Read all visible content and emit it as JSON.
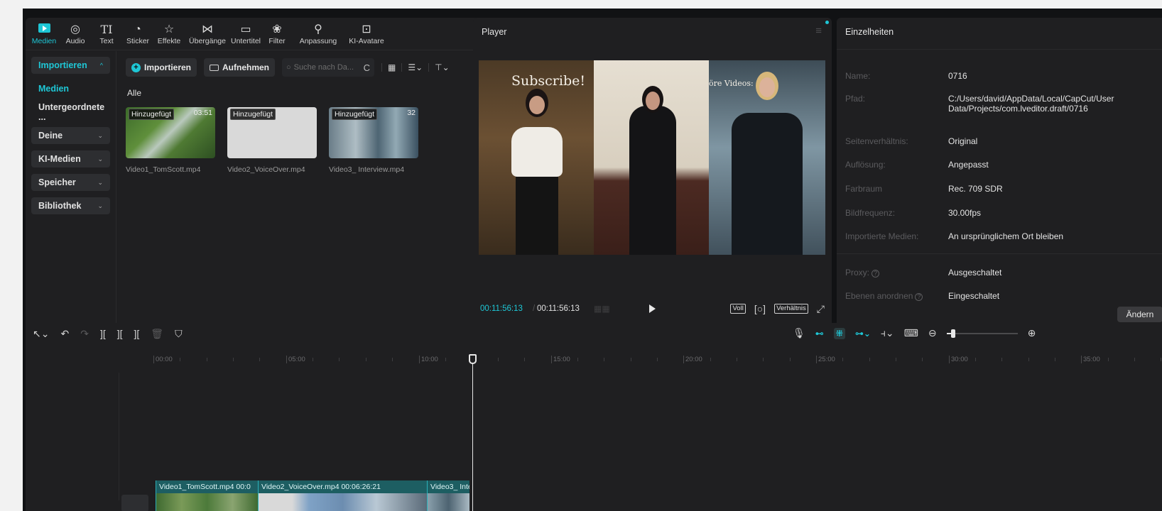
{
  "media_panel": {
    "tabs": [
      {
        "label": "Medien",
        "icon": "media-icon"
      },
      {
        "label": "Audio",
        "icon": "audio-icon"
      },
      {
        "label": "Text",
        "icon": "text-icon"
      },
      {
        "label": "Sticker",
        "icon": "sticker-icon"
      },
      {
        "label": "Effekte",
        "icon": "effects-icon"
      },
      {
        "label": "Übergänge",
        "icon": "transitions-icon"
      },
      {
        "label": "Untertitel",
        "icon": "subtitles-icon"
      },
      {
        "label": "Filter",
        "icon": "filter-icon"
      },
      {
        "label": "Anpassung",
        "icon": "adjust-icon"
      },
      {
        "label": "KI-Avatare",
        "icon": "ai-avatar-icon"
      }
    ],
    "sidebar": [
      {
        "label": "Importieren"
      },
      {
        "label": "Medien"
      },
      {
        "label": "Untergeordnete ..."
      },
      {
        "label": "Deine"
      },
      {
        "label": "KI-Medien"
      },
      {
        "label": "Speicher"
      },
      {
        "label": "Bibliothek"
      }
    ],
    "toolbar": {
      "import_label": "Importieren",
      "record_label": "Aufnehmen",
      "search_placeholder": "Suche nach Da..."
    },
    "section_label": "Alle",
    "items": [
      {
        "badge": "Hinzugefügt",
        "duration": "03:51",
        "name": "Video1_TomScott.mp4"
      },
      {
        "badge": "Hinzugefügt",
        "duration": "",
        "name": "Video2_VoiceOver.mp4"
      },
      {
        "badge": "Hinzugefügt",
        "duration": "32",
        "name": "Video3_ Interview.mp4"
      }
    ]
  },
  "player": {
    "title": "Player",
    "overlay_left": "Subscribe!",
    "overlay_right": "öre Videos:",
    "time_current": "00:11:56:13",
    "time_separator": "/",
    "time_total": "00:11:56:13",
    "full_label": "Voll",
    "ratio_label": "Verhältnis"
  },
  "details": {
    "title": "Einzelheiten",
    "rows": [
      {
        "key": "Name:",
        "value": "0716"
      },
      {
        "key": "Pfad:",
        "value": "C:/Users/david/AppData/Local/CapCut/User Data/Projects/com.lveditor.draft/0716"
      },
      {
        "key": "Seitenverhältnis:",
        "value": "Original"
      },
      {
        "key": "Auflösung:",
        "value": "Angepasst"
      },
      {
        "key": "Farbraum",
        "value": "Rec. 709 SDR"
      },
      {
        "key": "Bildfrequenz:",
        "value": "30.00fps"
      },
      {
        "key": "Importierte Medien:",
        "value": "An ursprünglichem Ort bleiben"
      },
      {
        "key": "Proxy:",
        "value": "Ausgeschaltet"
      },
      {
        "key": "Ebenen anordnen",
        "value": "Eingeschaltet"
      }
    ],
    "change_label": "Ändern"
  },
  "timeline": {
    "ruler": [
      "00:00",
      "05:00",
      "10:00",
      "15:00",
      "20:00",
      "25:00",
      "30:00",
      "35:00"
    ],
    "clips": [
      {
        "label": "Video1_TomScott.mp4  00:0"
      },
      {
        "label": "Video2_VoiceOver.mp4  00:06:26:21"
      },
      {
        "label": "Video3_ Inte"
      }
    ]
  },
  "colors": {
    "accent": "#1ec7d6",
    "panel": "#1f1f21",
    "background": "#111214"
  }
}
